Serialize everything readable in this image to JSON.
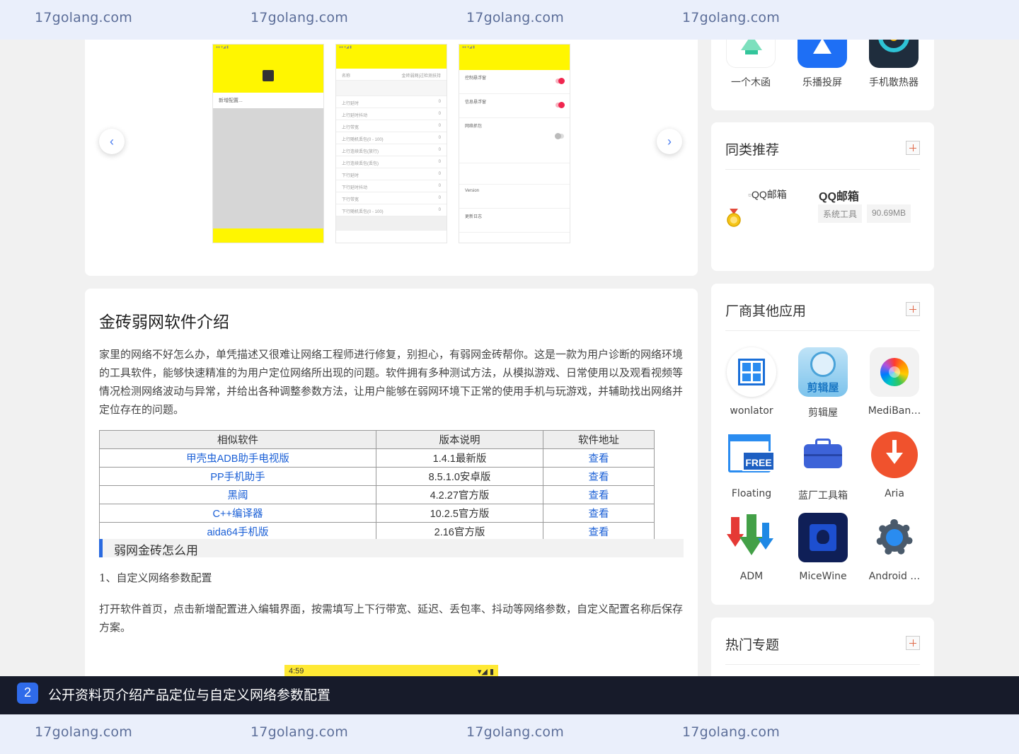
{
  "watermark": {
    "text": "17golang.com"
  },
  "gallery": {
    "prev_icon": "chevron-left-icon",
    "next_icon": "chevron-right-icon",
    "screens": {
      "s1_add": "新增配置...",
      "s2_rows": [
        "上行延时",
        "上行延时抖动",
        "上行带宽",
        "上行随机丢包(0 - 100)",
        "上行连续丢包(放行)",
        "上行连续丢包(丢包)",
        "下行延时",
        "下行延时抖动",
        "下行带宽",
        "下行随机丢包(0 - 100)"
      ],
      "s2_name_label": "名称",
      "s2_name_value": "金砖弱网|过检测扶持",
      "s3_sections": [
        "控制悬浮窗",
        "信息悬浮窗",
        "网络抓包",
        "Version",
        "更新日志"
      ]
    }
  },
  "article": {
    "title": "金砖弱网软件介绍",
    "intro": "家里的网络不好怎么办，单凭描述又很难让网络工程师进行修复，别担心，有弱网金砖帮你。这是一款为用户诊断的网络环境的工具软件，能够快速精准的为用户定位网络所出现的问题。软件拥有多种测试方法，从模拟游戏、日常使用以及观看视频等情况检测网络波动与异常，并给出各种调整参数方法，让用户能够在弱网环境下正常的使用手机与玩游戏，并辅助找出网络并定位存在的问题。",
    "table": {
      "headers": [
        "相似软件",
        "版本说明",
        "软件地址"
      ],
      "rows": [
        {
          "name": "甲壳虫ADB助手电视版",
          "version": "1.4.1最新版",
          "link": "查看"
        },
        {
          "name": "PP手机助手",
          "version": "8.5.1.0安卓版",
          "link": "查看"
        },
        {
          "name": "黑阈",
          "version": "4.2.27官方版",
          "link": "查看"
        },
        {
          "name": "C++编译器",
          "version": "10.2.5官方版",
          "link": "查看"
        },
        {
          "name": "aida64手机版",
          "version": "2.16官方版",
          "link": "查看"
        }
      ]
    },
    "section_heading": "弱网金砖怎么用",
    "step1": "1、自定义网络参数配置",
    "step1_desc": "打开软件首页，点击新增配置进入编辑界面，按需填写上下行带宽、延迟、丢包率、抖动等网络参数，自定义配置名称后保存方案。",
    "phone_time": "4:59"
  },
  "sidebar": {
    "top_apps": [
      {
        "label": "一个木函",
        "icon": "wooden-box-icon",
        "color": "#33c59b"
      },
      {
        "label": "乐播投屏",
        "icon": "lebo-cast-icon",
        "color": "#1e6ff5"
      },
      {
        "label": "手机散热器",
        "icon": "phone-cooler-icon",
        "color": "#1f2d3d"
      }
    ],
    "similar": {
      "title": "同类推荐",
      "broken_image": "QQ邮箱",
      "name": "QQ邮箱",
      "tags": [
        "系统工具",
        "90.69MB"
      ]
    },
    "vendor": {
      "title": "厂商其他应用",
      "apps": [
        {
          "label": "wonlator",
          "icon": "windows-grid-icon"
        },
        {
          "label": "剪辑屋",
          "icon": "anime-girl-icon"
        },
        {
          "label": "MediBan…",
          "icon": "color-wheel-icon"
        },
        {
          "label": "Floating",
          "icon": "free-window-icon"
        },
        {
          "label": "蓝厂工具箱",
          "icon": "toolbox-icon"
        },
        {
          "label": "Aria",
          "icon": "download-arrow-icon"
        },
        {
          "label": "ADM",
          "icon": "adm-arrows-icon"
        },
        {
          "label": "MiceWine",
          "icon": "micewine-icon"
        },
        {
          "label": "Android …",
          "icon": "gear-icon"
        }
      ]
    },
    "hot": {
      "title": "热门专题"
    }
  },
  "caption": {
    "number": "2",
    "text": "公开资料页介绍产品定位与自定义网络参数配置"
  }
}
